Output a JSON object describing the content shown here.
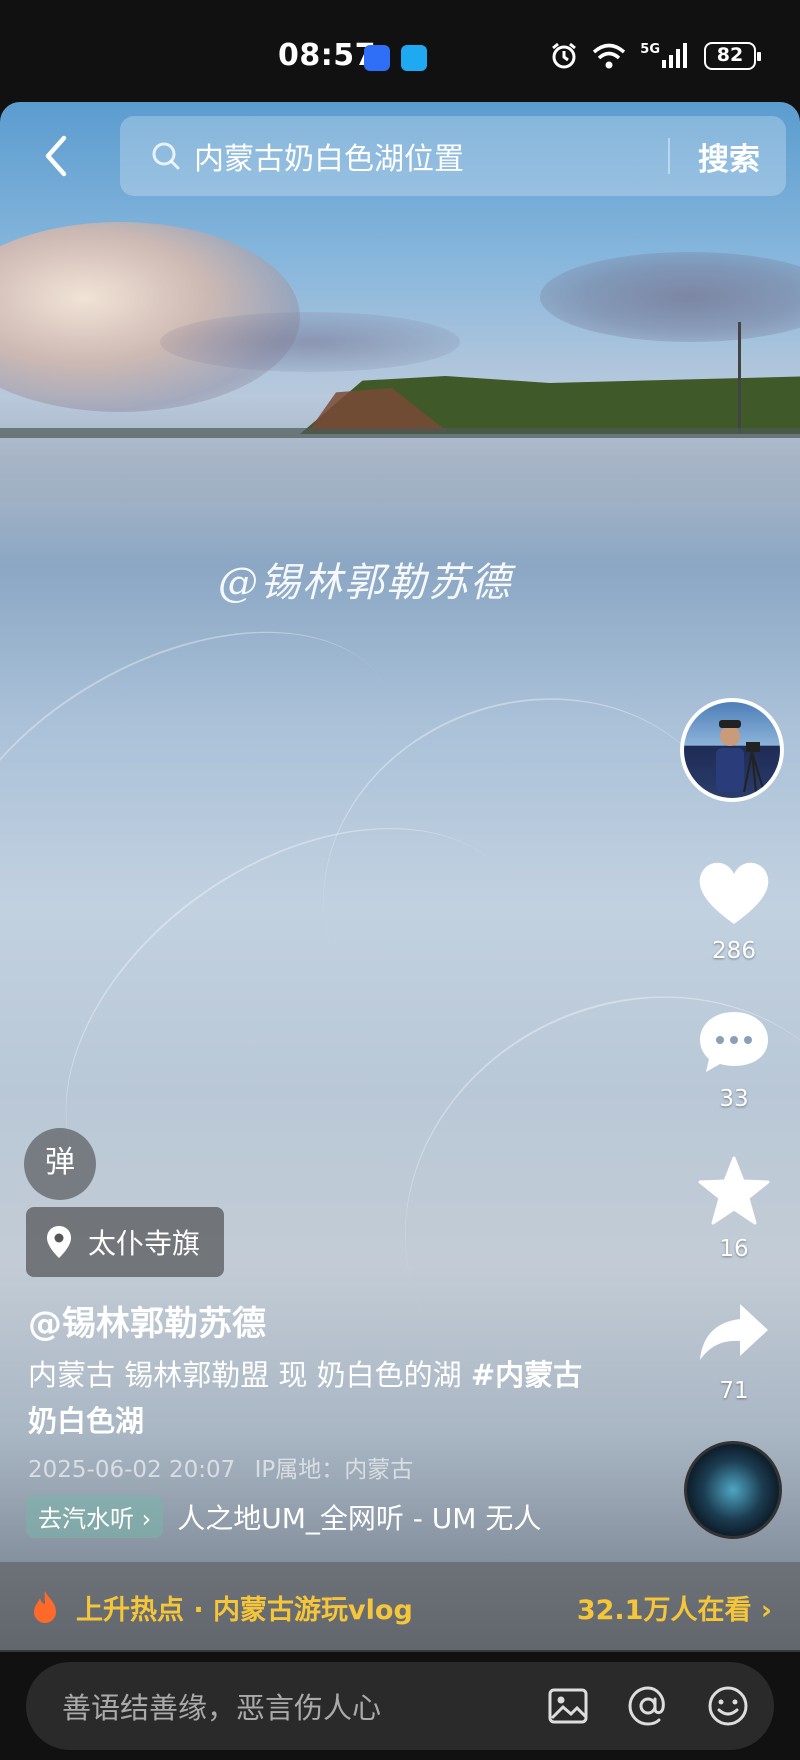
{
  "status_bar": {
    "time": "08:57",
    "network": "5G",
    "battery": "82"
  },
  "search": {
    "query": "内蒙古奶白色湖位置",
    "button": "搜索"
  },
  "video": {
    "watermark": "@锡林郭勒苏德"
  },
  "actions": {
    "likes": "286",
    "comments": "33",
    "favorites": "16",
    "shares": "71"
  },
  "info": {
    "danmu_label": "弹",
    "location": "太仆寺旗",
    "author": "@锡林郭勒苏德",
    "description": "内蒙古 锡林郭勒盟 现 奶白色的湖 ",
    "hashtag": "#内蒙古奶白色湖",
    "date": "2025-06-02 20:07",
    "ip": "IP属地：内蒙古"
  },
  "music": {
    "chip": "去汽水听",
    "title": "人之地UM_全网听 - UM    无人"
  },
  "hot_bar": {
    "label": "上升热点 · 内蒙古游玩vlog",
    "viewers": "32.1万人在看"
  },
  "comment": {
    "placeholder": "善语结善缘，恶言伤人心"
  },
  "colors": {
    "hot_accent": "#f5c53a",
    "music_chip": "#78b4aa"
  }
}
